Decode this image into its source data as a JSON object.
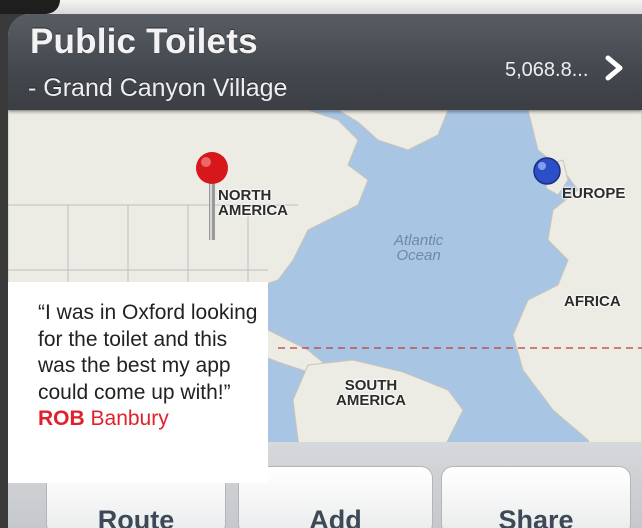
{
  "header": {
    "title": "Public Toilets",
    "subtitle": "- Grand Canyon Village",
    "distance": "5,068.8..."
  },
  "map": {
    "labels": {
      "north_america": "NORTH\nAMERICA",
      "europe": "EUROPE",
      "africa": "AFRICA",
      "south_america": "SOUTH\nAMERICA",
      "atlantic": "Atlantic\nOcean"
    },
    "pins": {
      "red_pin_color": "#d8171d",
      "blue_dot_color": "#2c4fc9"
    }
  },
  "quote": {
    "text": "“I was in Oxford looking for the toilet and this was the best my app could come up with!”",
    "author_first": "ROB",
    "author_last": "Banbury"
  },
  "toolbar": {
    "route": "Route",
    "add": "Add",
    "share": "Share"
  },
  "colors": {
    "header": "#43484e",
    "ocean": "#a8c4e3",
    "land": "#ecebe4",
    "accent_red": "#e0202a"
  }
}
